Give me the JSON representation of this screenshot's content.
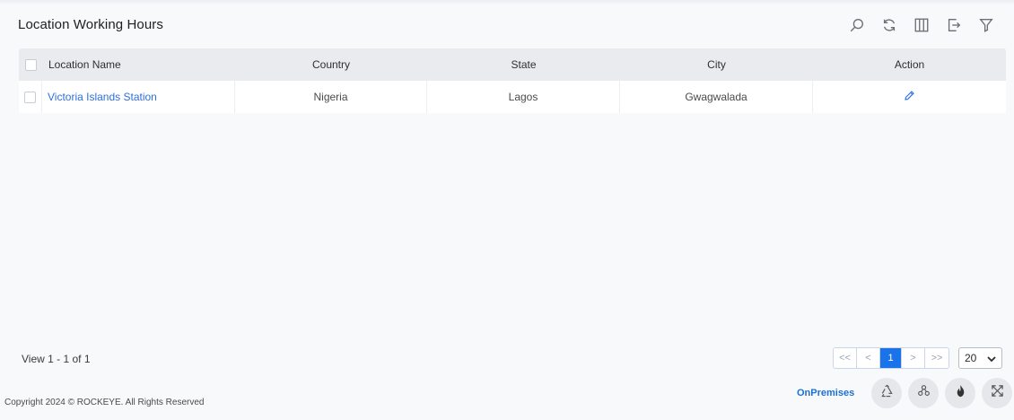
{
  "page": {
    "title": "Location Working Hours"
  },
  "toolbar": {
    "icons": [
      "search-icon",
      "refresh-icon",
      "columns-icon",
      "export-icon",
      "filter-icon"
    ]
  },
  "grid": {
    "columns": [
      "Location Name",
      "Country",
      "State",
      "City",
      "Action"
    ],
    "rows": [
      {
        "location_name": "Victoria Islands Station",
        "country": "Nigeria",
        "state": "Lagos",
        "city": "Gwagwalada",
        "action_icon": "edit-pencil-icon"
      }
    ]
  },
  "pager": {
    "info": "View 1 - 1 of 1",
    "first": "<<",
    "prev": "<",
    "current_page": "1",
    "next": ">",
    "last": ">>",
    "page_size": "20"
  },
  "footer": {
    "copyright": "Copyright 2024 © ROCKEYE. All Rights Reserved",
    "mode": "OnPremises",
    "fab_icons": [
      "recycle-icon",
      "nodes-icon",
      "flame-icon",
      "expand-icon"
    ]
  },
  "colors": {
    "accent": "#1a73e8",
    "link": "#2f6fd9",
    "header_bg": "#e9ebef",
    "page_bg": "#f8f9fb"
  }
}
